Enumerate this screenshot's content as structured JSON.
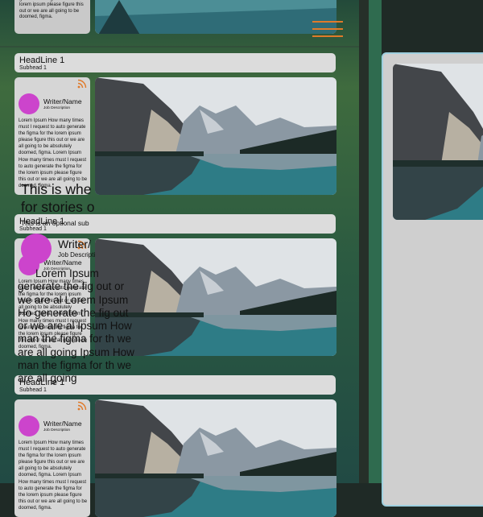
{
  "top_partial": {
    "body": "generate the figma for the lorem ipsum please figure this out or we are all going to be doomed, figma."
  },
  "stories": [
    {
      "headline": "HeadLine 1",
      "subhead": "Subhead 1",
      "writer": "Writer/Name",
      "job": "Job Description",
      "body": "Lorem Ipsum How many times must I request to auto generate the figma for the lorem ipsum please figure this out or we are all going to be absolutely doomed, figma. Lorem Ipsum How many times must I request to auto generate the figma for the lorem ipsum please figure this out or we are all going to be doomed, figma."
    },
    {
      "headline": "HeadLine 1",
      "subhead": "Subhead 1",
      "writer": "Writer/Name",
      "job": "Job Description",
      "body": "Lorem Ipsum How many times must I request to auto generate the figma for the lorem ipsum please figure this out or we are all going to be absolutely doomed, figma. Lorem Ipsum How many times must I request to auto generate the figma for the lorem ipsum please figure this out or we are all going to be doomed, figma."
    },
    {
      "headline": "HeadLine 1",
      "subhead": "Subhead 1",
      "writer": "Writer/Name",
      "job": "Job Description",
      "body": "Lorem Ipsum How many times must I request to auto generate the figma for the lorem ipsum please figure this out or we are all going to be absolutely doomed, figma. Lorem Ipsum How many times must I request to auto generate the figma for the lorem ipsum please figure this out or we are all going to be doomed, figma."
    }
  ],
  "feature": {
    "title_line1": "This is whe",
    "title_line2": "for stories o",
    "subtitle": "This is an optional sub",
    "writer": "Writer/",
    "job": "Job Descripti",
    "body": "Lorem Ipsum generate the fig out or we are al Lorem Ipsum Ho generate the fig out or we are al Ipsum How man the figma for th we are all going Ipsum How man the figma for th we are all going"
  },
  "icons": {
    "menu": "hamburger-menu-icon",
    "feed": "rss-icon"
  },
  "colors": {
    "accent": "#e07a2a",
    "avatar": "#cc44cc",
    "panel_border": "#9fd0df"
  }
}
